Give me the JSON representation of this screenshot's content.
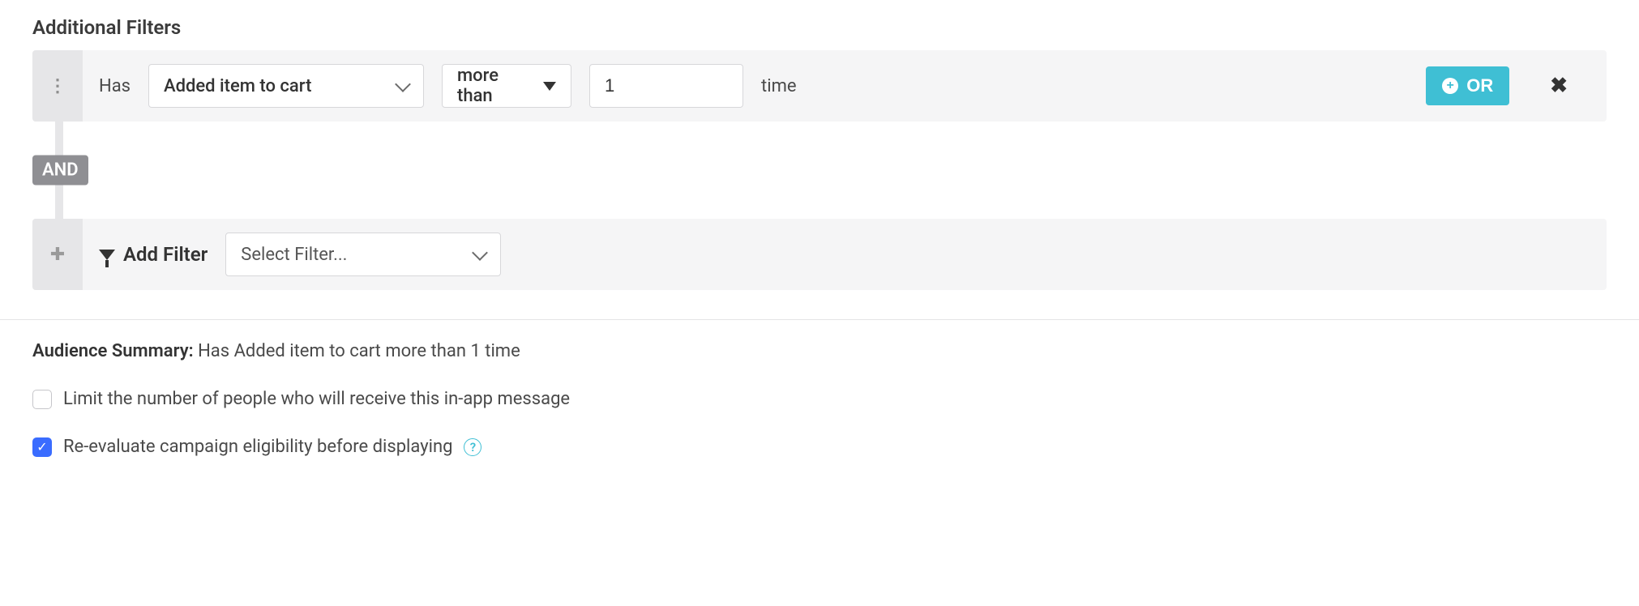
{
  "section_title": "Additional Filters",
  "filter1": {
    "has_label": "Has",
    "event": "Added item to cart",
    "operator": "more than",
    "count": "1",
    "unit": "time",
    "or_label": "OR"
  },
  "connector": "AND",
  "add_filter": {
    "label": "Add Filter",
    "placeholder": "Select Filter..."
  },
  "summary": {
    "prefix": "Audience Summary:",
    "text": "Has Added item to cart more than 1 time"
  },
  "limit_checkbox": {
    "checked": false,
    "label": "Limit the number of people who will receive this in-app message"
  },
  "reeval_checkbox": {
    "checked": true,
    "label": "Re-evaluate campaign eligibility before displaying"
  }
}
